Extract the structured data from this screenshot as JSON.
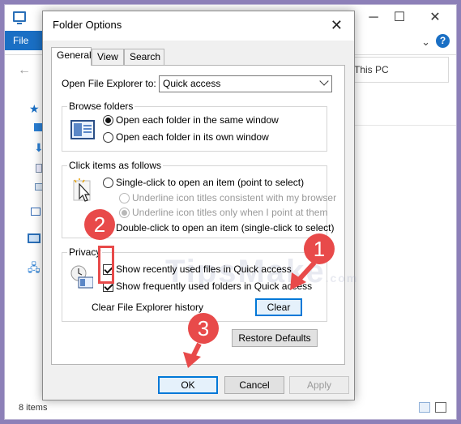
{
  "explorer": {
    "file_tab": "File",
    "address_text": "This PC",
    "status_text": "8 items",
    "min": "─",
    "max": "☐",
    "close": "✕",
    "chevron": "⌄",
    "help": "?",
    "back": "←"
  },
  "dialog": {
    "title": "Folder Options",
    "close": "✕",
    "tabs": [
      {
        "label": "General",
        "active": true
      },
      {
        "label": "View",
        "active": false
      },
      {
        "label": "Search",
        "active": false
      }
    ],
    "open_to_label": "Open File Explorer to:",
    "open_to_value": "Quick access",
    "browse": {
      "title": "Browse folders",
      "option1": "Open each folder in the same window",
      "option2": "Open each folder in its own window"
    },
    "click": {
      "title": "Click items as follows",
      "single": "Single-click to open an item (point to select)",
      "underline_consistent": "Underline icon titles consistent with my browser",
      "underline_point": "Underline icon titles only when I point at them",
      "double": "Double-click to open an item (single-click to select)"
    },
    "privacy": {
      "title": "Privacy",
      "recent": "Show recently used files in Quick access",
      "frequent": "Show frequently used folders in Quick access",
      "clear_label": "Clear File Explorer history",
      "clear_button": "Clear"
    },
    "restore_button": "Restore Defaults",
    "ok": "OK",
    "cancel": "Cancel",
    "apply": "Apply"
  },
  "watermark": {
    "text": "TipsMake",
    "suffix": ".com"
  },
  "annotations": {
    "one": "1",
    "two": "2",
    "three": "3",
    "color": "#e84a4a"
  }
}
